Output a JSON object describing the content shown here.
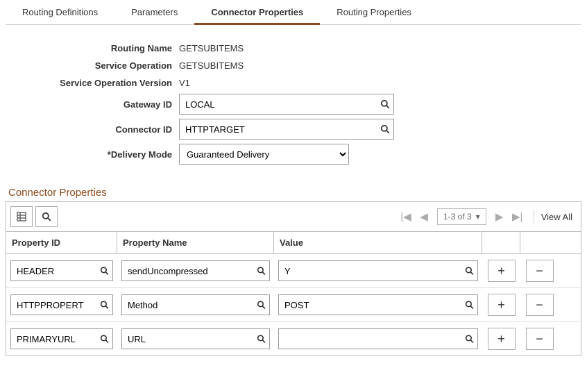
{
  "tabs": {
    "t0": "Routing Definitions",
    "t1": "Parameters",
    "t2": "Connector Properties",
    "t3": "Routing Properties"
  },
  "form": {
    "routing_name_label": "Routing Name",
    "routing_name": "GETSUBITEMS",
    "service_op_label": "Service Operation",
    "service_op": "GETSUBITEMS",
    "service_ver_label": "Service Operation Version",
    "service_ver": "V1",
    "gateway_label": "Gateway ID",
    "gateway": "LOCAL",
    "connector_label": "Connector ID",
    "connector": "HTTPTARGET",
    "delivery_label": "*Delivery Mode",
    "delivery": "Guaranteed Delivery"
  },
  "section_title": "Connector Properties",
  "grid": {
    "range": "1-3 of 3",
    "view_all": "View All",
    "head_pid": "Property ID",
    "head_pname": "Property Name",
    "head_val": "Value",
    "rows": [
      {
        "pid": "HEADER",
        "pname": "sendUncompressed",
        "val": "Y"
      },
      {
        "pid": "HTTPPROPERT",
        "pname": "Method",
        "val": "POST"
      },
      {
        "pid": "PRIMARYURL",
        "pname": "URL",
        "val": ""
      }
    ]
  }
}
